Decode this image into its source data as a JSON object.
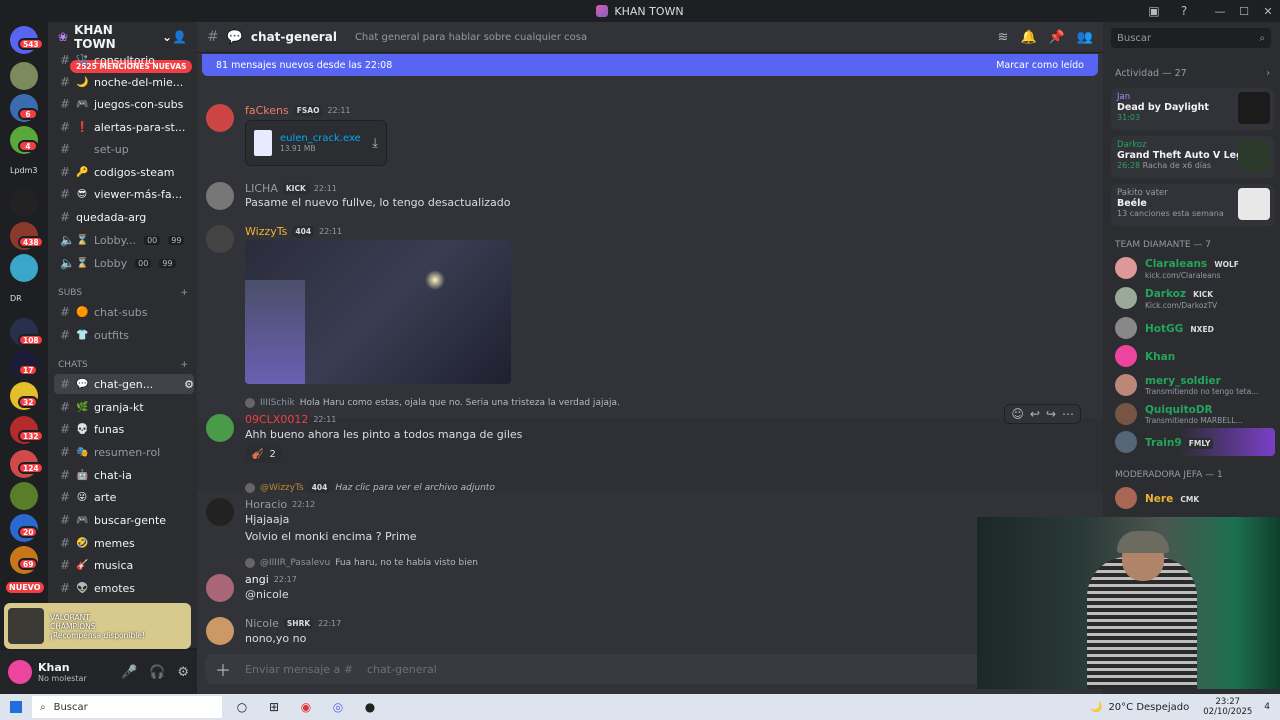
{
  "window": {
    "title": "KHAN TOWN"
  },
  "rail": {
    "badges": [
      "543",
      "6",
      "4",
      "438",
      "108",
      "17",
      "32",
      "132",
      "124",
      "20",
      "69"
    ],
    "labels": [
      "Lpdm3",
      "DR",
      "NUEVO"
    ]
  },
  "sidebar": {
    "server_name": "KHAN TOWN",
    "mention_banner": "2525 MENCIONES NUEVAS",
    "channels": [
      {
        "name": "consultorio",
        "emoji": "🩺"
      },
      {
        "name": "noche-del-mie...",
        "emoji": "🌙"
      },
      {
        "name": "juegos-con-subs",
        "emoji": "🎮"
      },
      {
        "name": "alertas-para-st...",
        "emoji": "❗"
      },
      {
        "name": "set-up",
        "emoji": ""
      },
      {
        "name": "codigos-steam",
        "emoji": "🔑"
      },
      {
        "name": "viewer-más-fa...",
        "emoji": "😎"
      },
      {
        "name": "quedada-arg",
        "emoji": ""
      },
      {
        "name": "Lobby...",
        "emoji": "⌛",
        "c1": "00",
        "c2": "99"
      },
      {
        "name": "Lobby",
        "emoji": "⌛",
        "c1": "00",
        "c2": "99"
      }
    ],
    "cat_subs": "SUBS",
    "subs_channels": [
      {
        "name": "chat-subs",
        "emoji": "🟠"
      },
      {
        "name": "outfits",
        "emoji": "👕"
      }
    ],
    "cat_chats": "CHATS",
    "chats_channels": [
      {
        "name": "chat-gen...",
        "emoji": "💬"
      },
      {
        "name": "granja-kt",
        "emoji": "🌿"
      },
      {
        "name": "funas",
        "emoji": "💀"
      },
      {
        "name": "resumen-rol",
        "emoji": "🎭"
      },
      {
        "name": "chat-ia",
        "emoji": "🤖"
      },
      {
        "name": "arte",
        "emoji": "😜"
      },
      {
        "name": "buscar-gente",
        "emoji": "🎮"
      },
      {
        "name": "memes",
        "emoji": "🤣"
      },
      {
        "name": "musica",
        "emoji": "🎸"
      },
      {
        "name": "emotes",
        "emoji": "👽"
      }
    ],
    "promo": {
      "line1": "VALORANT",
      "line2": "CHAMPIONS",
      "line3": "¡Recompensa disponible!"
    },
    "user": {
      "name": "Khan",
      "status": "No molestar"
    }
  },
  "channel": {
    "name": "chat-general",
    "topic": "Chat general para hablar sobre cualquier cosa",
    "new_messages": "81 mensajes nuevos desde las 22:08",
    "mark_read": "Marcar como leído",
    "composer_placeholder": "Enviar mensaje a #",
    "composer_channel": "chat-general"
  },
  "messages": [
    {
      "author": "faCkens",
      "tag": "FSAO",
      "time": "22:11",
      "file": {
        "name": "eulen_crack.exe",
        "size": "13.91 MB"
      },
      "color": "#f47b67"
    },
    {
      "author": "LICHA",
      "tag": "KICK",
      "time": "22:11",
      "text": "Pasame el nuevo fullve, lo tengo desactualizado",
      "color": "#949ba4"
    },
    {
      "author": "WizzyTs",
      "tag": "404",
      "time": "22:11",
      "color": "#f0b232"
    },
    {
      "reply_author": "IIIISchik",
      "reply": "Hola Haru como estas, ojala que no. Seria una tristeza la verdad jajaja.",
      "author": "09CLX0012",
      "time": "22:11",
      "text": "Ahh bueno ahora les pinto a todos manga de giles",
      "reaction": "2",
      "color": "#f23f43"
    },
    {
      "reply_author": "@WizzyTs",
      "reply_tag": "404",
      "reply": "Haz clic para ver el archivo adjunto",
      "author": "Horacio",
      "time": "22:12",
      "text": "Hjajaaja",
      "text2": "Volvio el monki encima ? Prime",
      "color": "#949ba4"
    },
    {
      "reply_author": "@IIIIR_Pasalevu",
      "reply": "Fua haru, no te había visto bien",
      "author": "angi",
      "time": "22:17",
      "text": "@nicole",
      "color": "#f2f3f5"
    },
    {
      "author": "Nicole",
      "tag": "SHRK",
      "time": "22:17",
      "text": "nono,yo no",
      "color": "#949ba4"
    }
  ],
  "members": {
    "search_placeholder": "Buscar",
    "activity_header": "Actividad — 27",
    "activity": [
      {
        "user": "Jan",
        "game": "Dead by Daylight",
        "detail": "31:03"
      },
      {
        "user": "Darkoz",
        "game": "Grand Theft Auto V Legacy",
        "detail": "26:28",
        "extra": "Racha de x6 días"
      },
      {
        "user": "Pakito vater",
        "game": "Beéle",
        "detail": "13 canciones esta semana"
      }
    ],
    "cat_team": "TEAM DIAMANTE — 7",
    "team": [
      {
        "name": "Claraleans",
        "tag": "WOLF",
        "status": "kick.com/Claraleans",
        "color": "#23a55a"
      },
      {
        "name": "Darkoz",
        "tag": "KICK",
        "status": "Kick.com/DarkozTV",
        "color": "#23a55a"
      },
      {
        "name": "HotGG",
        "tag": "NXED",
        "status": "",
        "color": "#23a55a"
      },
      {
        "name": "Khan",
        "tag": "",
        "status": "",
        "color": "#23a55a"
      },
      {
        "name": "mery_soldier",
        "tag": "",
        "status": "Transmitiendo no tengo teta...",
        "color": "#23a55a"
      },
      {
        "name": "QuiquitoDR",
        "tag": "",
        "status": "Transmitiendo MARBELL...",
        "color": "#23a55a"
      },
      {
        "name": "Train9",
        "tag": "FMLY",
        "status": "",
        "color": "#23a55a"
      }
    ],
    "cat_mod": "MODERADORA JEFA — 1",
    "mods": [
      {
        "name": "Nere",
        "tag": "CMK",
        "color": "#f0b232"
      }
    ]
  },
  "taskbar": {
    "search": "Buscar",
    "weather": "20°C  Despejado",
    "time": "23:27",
    "date": "02/10/2025",
    "notif": "4"
  }
}
